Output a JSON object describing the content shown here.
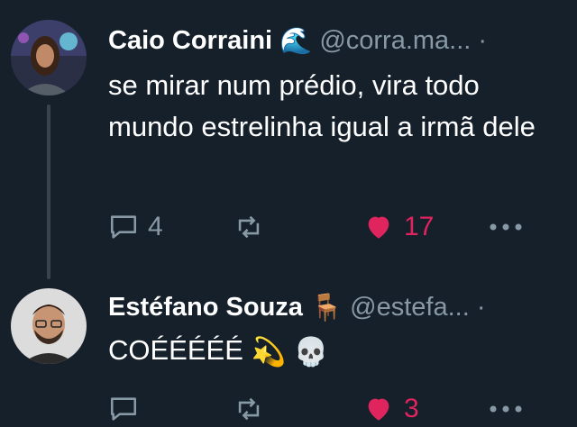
{
  "tweets": [
    {
      "name": "Caio Corraini",
      "name_emoji": "🌊",
      "handle": "@corra.ma...",
      "separator": "·",
      "text": "se mirar num prédio, vira todo mundo estrelinha igual a irmã dele",
      "replies": "4",
      "likes": "17",
      "liked": true
    },
    {
      "name": "Estéfano Souza",
      "name_emoji": "🪑",
      "handle": "@estefa...",
      "separator": "·",
      "text": "COÉÉÉÉÉ",
      "text_emojis": [
        "💫",
        "💀"
      ],
      "replies": "",
      "likes": "3",
      "liked": true
    }
  ],
  "colors": {
    "background": "#15202b",
    "text_primary": "#ffffff",
    "text_secondary": "#8899a6",
    "like_active": "#e0245e",
    "thread_line": "#38444d"
  },
  "icons": [
    "reply-icon",
    "retweet-icon",
    "heart-icon",
    "more-icon"
  ]
}
